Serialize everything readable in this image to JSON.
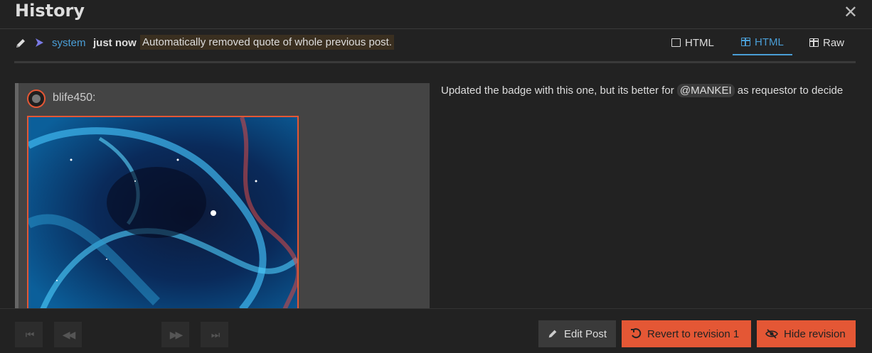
{
  "modal": {
    "title": "History",
    "close_glyph": "✕"
  },
  "revision": {
    "user": "system",
    "time": "just now",
    "reason": "Automatically removed quote of whole previous post."
  },
  "tabs": [
    {
      "label": "HTML",
      "icon": "square-icon",
      "active": false
    },
    {
      "label": "HTML",
      "icon": "split-view-icon",
      "active": true
    },
    {
      "label": "Raw",
      "icon": "split-view-icon",
      "active": false
    }
  ],
  "quote": {
    "author": "blife450:"
  },
  "body": {
    "text_before": "Updated the badge with this one, but its better for ",
    "mention": "@MANKEI",
    "text_after": " as requestor to decide"
  },
  "footer": {
    "first_glyph": "⏮",
    "prev_glyph": "◀◀",
    "next_glyph": "▶▶",
    "last_glyph": "⏭",
    "edit_label": "Edit Post",
    "revert_label": "Revert to revision 1",
    "hide_label": "Hide revision"
  },
  "colors": {
    "accent": "#4a9ed6",
    "danger": "#e45735",
    "background": "#222222"
  }
}
